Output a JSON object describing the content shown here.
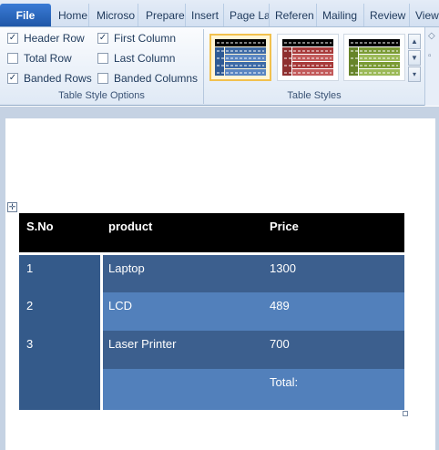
{
  "tabs": {
    "file": "File",
    "items": [
      "Home",
      "Microso",
      "Prepare",
      "Insert",
      "Page La",
      "Referen",
      "Mailing",
      "Review",
      "View"
    ]
  },
  "table_style_options": {
    "header_row": {
      "label": "Header Row",
      "checked": true
    },
    "total_row": {
      "label": "Total Row",
      "checked": false
    },
    "banded_rows": {
      "label": "Banded Rows",
      "checked": true
    },
    "first_column": {
      "label": "First Column",
      "checked": true
    },
    "last_column": {
      "label": "Last Column",
      "checked": false
    },
    "banded_columns": {
      "label": "Banded Columns",
      "checked": false
    },
    "group_label": "Table Style Options"
  },
  "table_styles": {
    "group_label": "Table Styles",
    "styles": [
      {
        "name": "style-blue",
        "color": "#3d6aa6",
        "selected": true
      },
      {
        "name": "style-red",
        "color": "#a73a3a",
        "selected": false
      },
      {
        "name": "style-green",
        "color": "#7a9a34",
        "selected": false
      }
    ]
  },
  "table": {
    "headers": [
      "S.No",
      "product",
      "Price"
    ],
    "rows": [
      [
        "1",
        "Laptop",
        "1300"
      ],
      [
        "2",
        "LCD",
        "489"
      ],
      [
        "3",
        "Laser Printer",
        "700"
      ],
      [
        "",
        "",
        "Total:"
      ]
    ]
  },
  "colors": {
    "header": "#000000",
    "band_dark": "#3c5f8e",
    "band_light": "#5280bb",
    "first_column": "#345a8a"
  }
}
